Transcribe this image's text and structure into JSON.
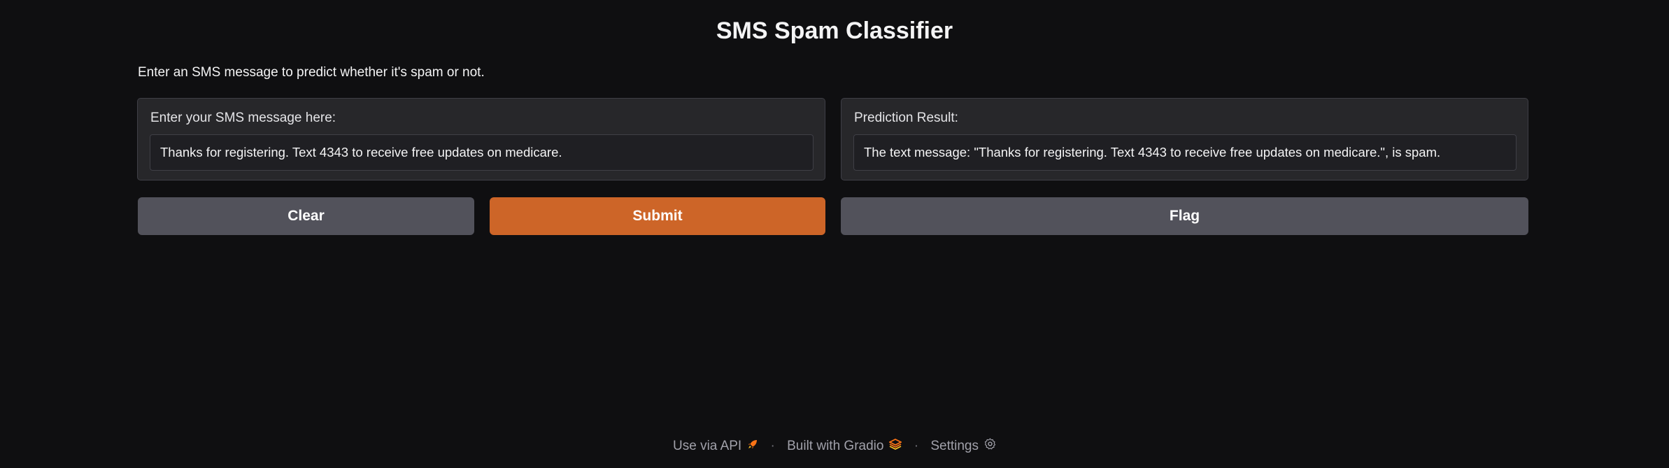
{
  "app": {
    "title": "SMS Spam Classifier",
    "description": "Enter an SMS message to predict whether it's spam or not."
  },
  "input_panel": {
    "label": "Enter your SMS message here:",
    "value": "Thanks for registering. Text 4343 to receive free updates on medicare."
  },
  "output_panel": {
    "label": "Prediction Result:",
    "value": "The text message: \"Thanks for registering. Text 4343 to receive free updates on medicare.\", is spam."
  },
  "buttons": {
    "clear": "Clear",
    "submit": "Submit",
    "flag": "Flag"
  },
  "footer": {
    "api_label": "Use via API",
    "built_label": "Built with Gradio",
    "settings_label": "Settings",
    "separator": "·",
    "icons": [
      "rocket-icon",
      "gradio-logo-icon",
      "gear-icon"
    ]
  },
  "colors": {
    "background": "#0f0f11",
    "panel": "#27272a",
    "accent": "#cd6528",
    "secondary_button": "#52525b"
  }
}
